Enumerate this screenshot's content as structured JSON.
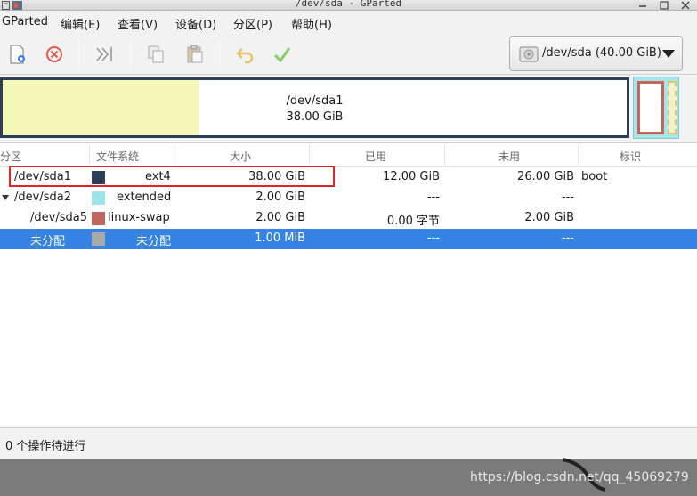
{
  "window": {
    "title": "/dev/sda - GParted"
  },
  "menu": [
    "GParted",
    "编辑(E)",
    "查看(V)",
    "设备(D)",
    "分区(P)",
    "帮助(H)"
  ],
  "toolbar": {
    "icons": [
      "new-partition-icon",
      "delete-icon",
      "resize-move-icon",
      "copy-icon",
      "paste-icon",
      "undo-icon",
      "apply-icon"
    ],
    "device": "/dev/sda (40.00 GiB)"
  },
  "diskmap": {
    "name": "/dev/sda1",
    "size": "38.00 GiB"
  },
  "table": {
    "headers": [
      "分区",
      "文件系统",
      "大小",
      "已用",
      "未用",
      "标识"
    ],
    "rows": [
      {
        "partition": "/dev/sda1",
        "fs": "ext4",
        "size": "38.00 GiB",
        "used": "12.00 GiB",
        "unused": "26.00 GiB",
        "flags": "boot",
        "color": "#2c3e58"
      },
      {
        "partition": "/dev/sda2",
        "fs": "extended",
        "size": "2.00 GiB",
        "used": "---",
        "unused": "---",
        "flags": "",
        "color": "#9de4e8"
      },
      {
        "partition": "/dev/sda5",
        "fs": "linux-swap",
        "size": "2.00 GiB",
        "used": "0.00 字节",
        "unused": "2.00 GiB",
        "flags": "",
        "color": "#c0665c"
      },
      {
        "partition": "未分配",
        "fs": "未分配",
        "size": "1.00 MiB",
        "used": "---",
        "unused": "---",
        "flags": "",
        "color": "#a9a9a9"
      }
    ]
  },
  "status": "0 个操作待进行",
  "watermark": "https://blog.csdn.net/qq_45069279",
  "colors": {
    "selection": "#3584e4",
    "highlight": "#e0242b",
    "unallocated": "#f7f7b8"
  }
}
